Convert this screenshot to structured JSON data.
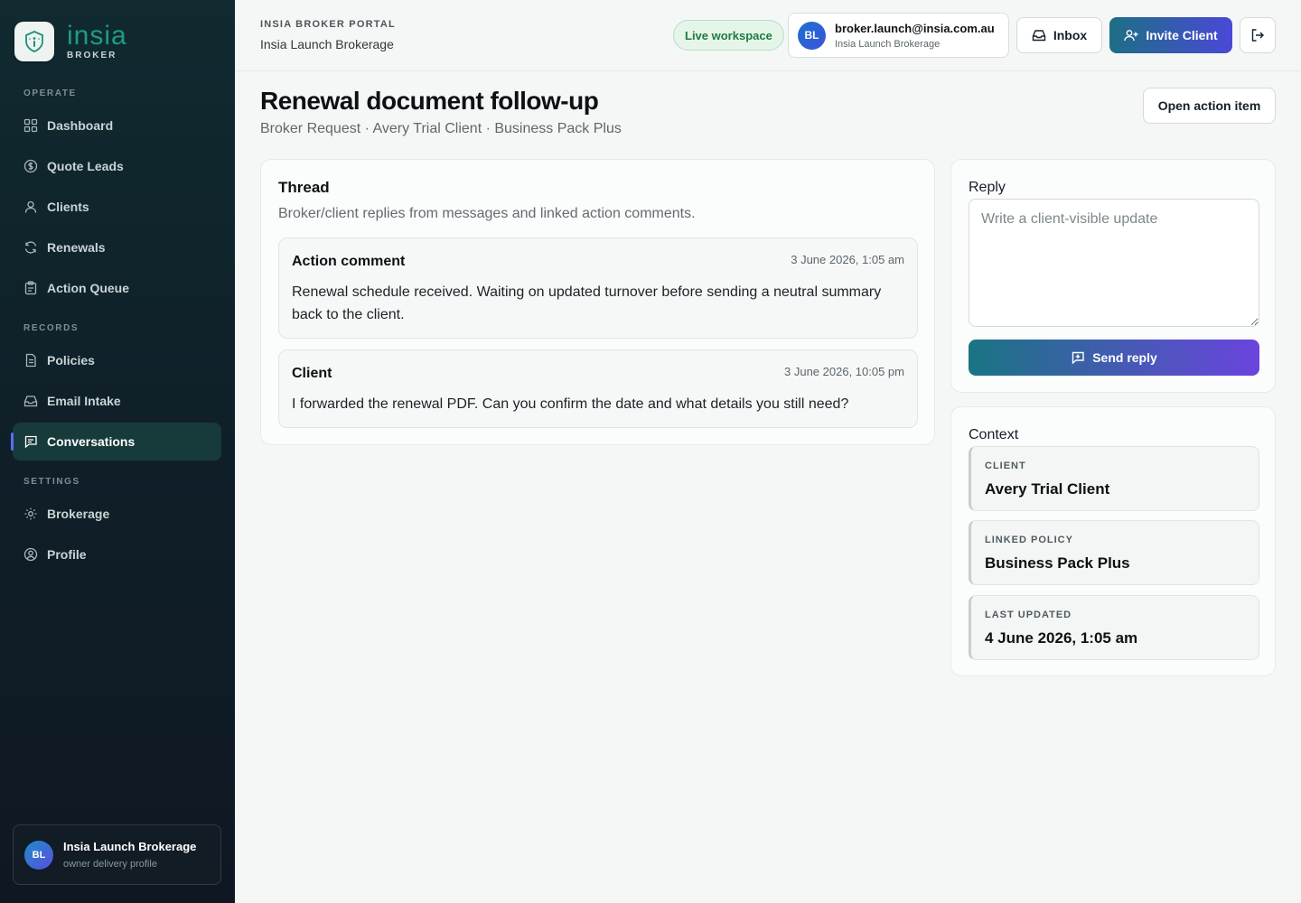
{
  "brand": {
    "name": "insia",
    "sub": "BROKER"
  },
  "sidebar": {
    "sections": [
      {
        "label": "OPERATE"
      },
      {
        "label": "RECORDS"
      },
      {
        "label": "SETTINGS"
      }
    ],
    "items": [
      {
        "label": "Dashboard",
        "icon": "dashboard-icon"
      },
      {
        "label": "Quote Leads",
        "icon": "dollar-icon"
      },
      {
        "label": "Clients",
        "icon": "user-icon"
      },
      {
        "label": "Renewals",
        "icon": "refresh-icon"
      },
      {
        "label": "Action Queue",
        "icon": "clipboard-icon"
      },
      {
        "label": "Policies",
        "icon": "document-icon"
      },
      {
        "label": "Email Intake",
        "icon": "inbox-icon"
      },
      {
        "label": "Conversations",
        "icon": "chat-icon",
        "active": true
      },
      {
        "label": "Brokerage",
        "icon": "gear-icon"
      },
      {
        "label": "Profile",
        "icon": "profile-icon"
      }
    ],
    "profile": {
      "initials": "BL",
      "name": "Insia Launch Brokerage",
      "role": "owner delivery profile"
    }
  },
  "header": {
    "portal_label": "INSIA BROKER PORTAL",
    "portal_name": "Insia Launch Brokerage",
    "live_label": "Live workspace",
    "account": {
      "initials": "BL",
      "email": "broker.launch@insia.com.au",
      "org": "Insia Launch Brokerage"
    },
    "inbox_label": "Inbox",
    "invite_label": "Invite Client"
  },
  "page": {
    "title": "Renewal document follow-up",
    "subtitle": "Broker Request · Avery Trial Client · Business Pack Plus",
    "open_action_label": "Open action item"
  },
  "thread": {
    "title": "Thread",
    "description": "Broker/client replies from messages and linked action comments.",
    "messages": [
      {
        "author": "Action comment",
        "time": "3 June 2026, 1:05 am",
        "body": "Renewal schedule received. Waiting on updated turnover before sending a neutral summary back to the client."
      },
      {
        "author": "Client",
        "time": "3 June 2026, 10:05 pm",
        "body": "I forwarded the renewal PDF. Can you confirm the date and what details you still need?"
      }
    ]
  },
  "reply": {
    "label": "Reply",
    "placeholder": "Write a client-visible update",
    "value": "",
    "send_label": "Send reply"
  },
  "context": {
    "label": "Context",
    "items": [
      {
        "label": "CLIENT",
        "value": "Avery Trial Client"
      },
      {
        "label": "LINKED POLICY",
        "value": "Business Pack Plus"
      },
      {
        "label": "LAST UPDATED",
        "value": "4 June 2026, 1:05 am"
      }
    ]
  },
  "colors": {
    "brand_teal": "#1f9b86",
    "accent_gradient_start": "#1d6f84",
    "accent_gradient_end": "#4a48d8",
    "live_green": "#1e7c3e"
  }
}
